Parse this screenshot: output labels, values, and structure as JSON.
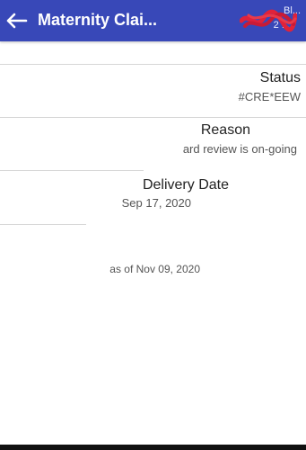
{
  "header": {
    "title": "Maternity Clai...",
    "meta_line_1": "Bl...",
    "meta_line_2": "2 ...",
    "bar_color": "#3848b8",
    "back_icon": "arrow-left-icon"
  },
  "details": [
    {
      "label": "Status",
      "value": "#CRE*EEW"
    },
    {
      "label": "Reason",
      "value": "ard review is on-going"
    },
    {
      "label": "Delivery Date",
      "value": "Sep 17, 2020"
    }
  ],
  "footer": {
    "as_of": "as of Nov 09, 2020"
  }
}
